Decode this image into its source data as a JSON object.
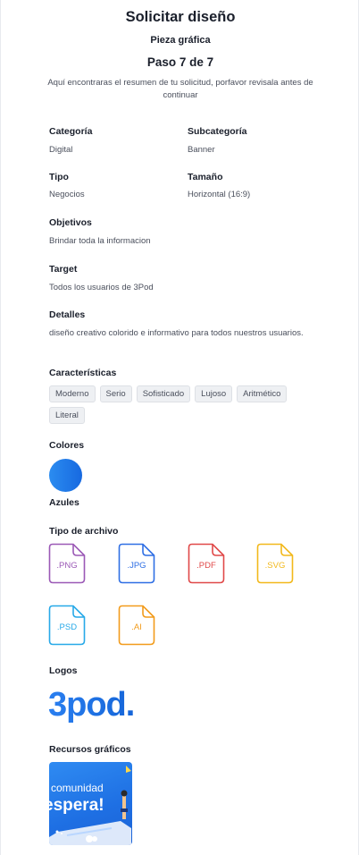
{
  "header": {
    "title": "Solicitar diseño",
    "subtitle": "Pieza gráfica",
    "step": "Paso 7 de 7",
    "intro": "Aquí encontraras el resumen de tu solicitud, porfavor revisala antes de continuar"
  },
  "summary": {
    "categoria": {
      "label": "Categoría",
      "value": "Digital"
    },
    "subcategoria": {
      "label": "Subcategoría",
      "value": "Banner"
    },
    "tipo": {
      "label": "Tipo",
      "value": "Negocios"
    },
    "tamano": {
      "label": "Tamaño",
      "value": "Horizontal (16:9)"
    },
    "objetivos": {
      "label": "Objetivos",
      "value": "Brindar toda la informacion"
    },
    "target": {
      "label": "Target",
      "value": "Todos los usuarios de 3Pod"
    },
    "detalles": {
      "label": "Detalles",
      "value": "diseño creativo colorido e informativo para todos nuestros usuarios."
    }
  },
  "caracteristicas": {
    "label": "Características",
    "items": [
      "Moderno",
      "Serio",
      "Sofisticado",
      "Lujoso",
      "Aritmético",
      "Literal"
    ]
  },
  "colores": {
    "label": "Colores",
    "swatch_name": "Azules",
    "swatch_colors": [
      "#2b8cf0",
      "#1769e0"
    ]
  },
  "archivo": {
    "label": "Tipo de archivo",
    "types": [
      {
        "ext": ".PNG",
        "color": "#9b59b6"
      },
      {
        "ext": ".JPG",
        "color": "#2f6fe4"
      },
      {
        "ext": ".PDF",
        "color": "#e04848"
      },
      {
        "ext": ".SVG",
        "color": "#f2b81b"
      },
      {
        "ext": ".PSD",
        "color": "#27a9e8"
      },
      {
        "ext": ".AI",
        "color": "#f29b1b"
      }
    ]
  },
  "logos": {
    "label": "Logos",
    "logo_text": "3pod."
  },
  "recursos": {
    "label": "Recursos gráficos",
    "preview_line1": "e comunidad",
    "preview_line2": "espera!"
  }
}
